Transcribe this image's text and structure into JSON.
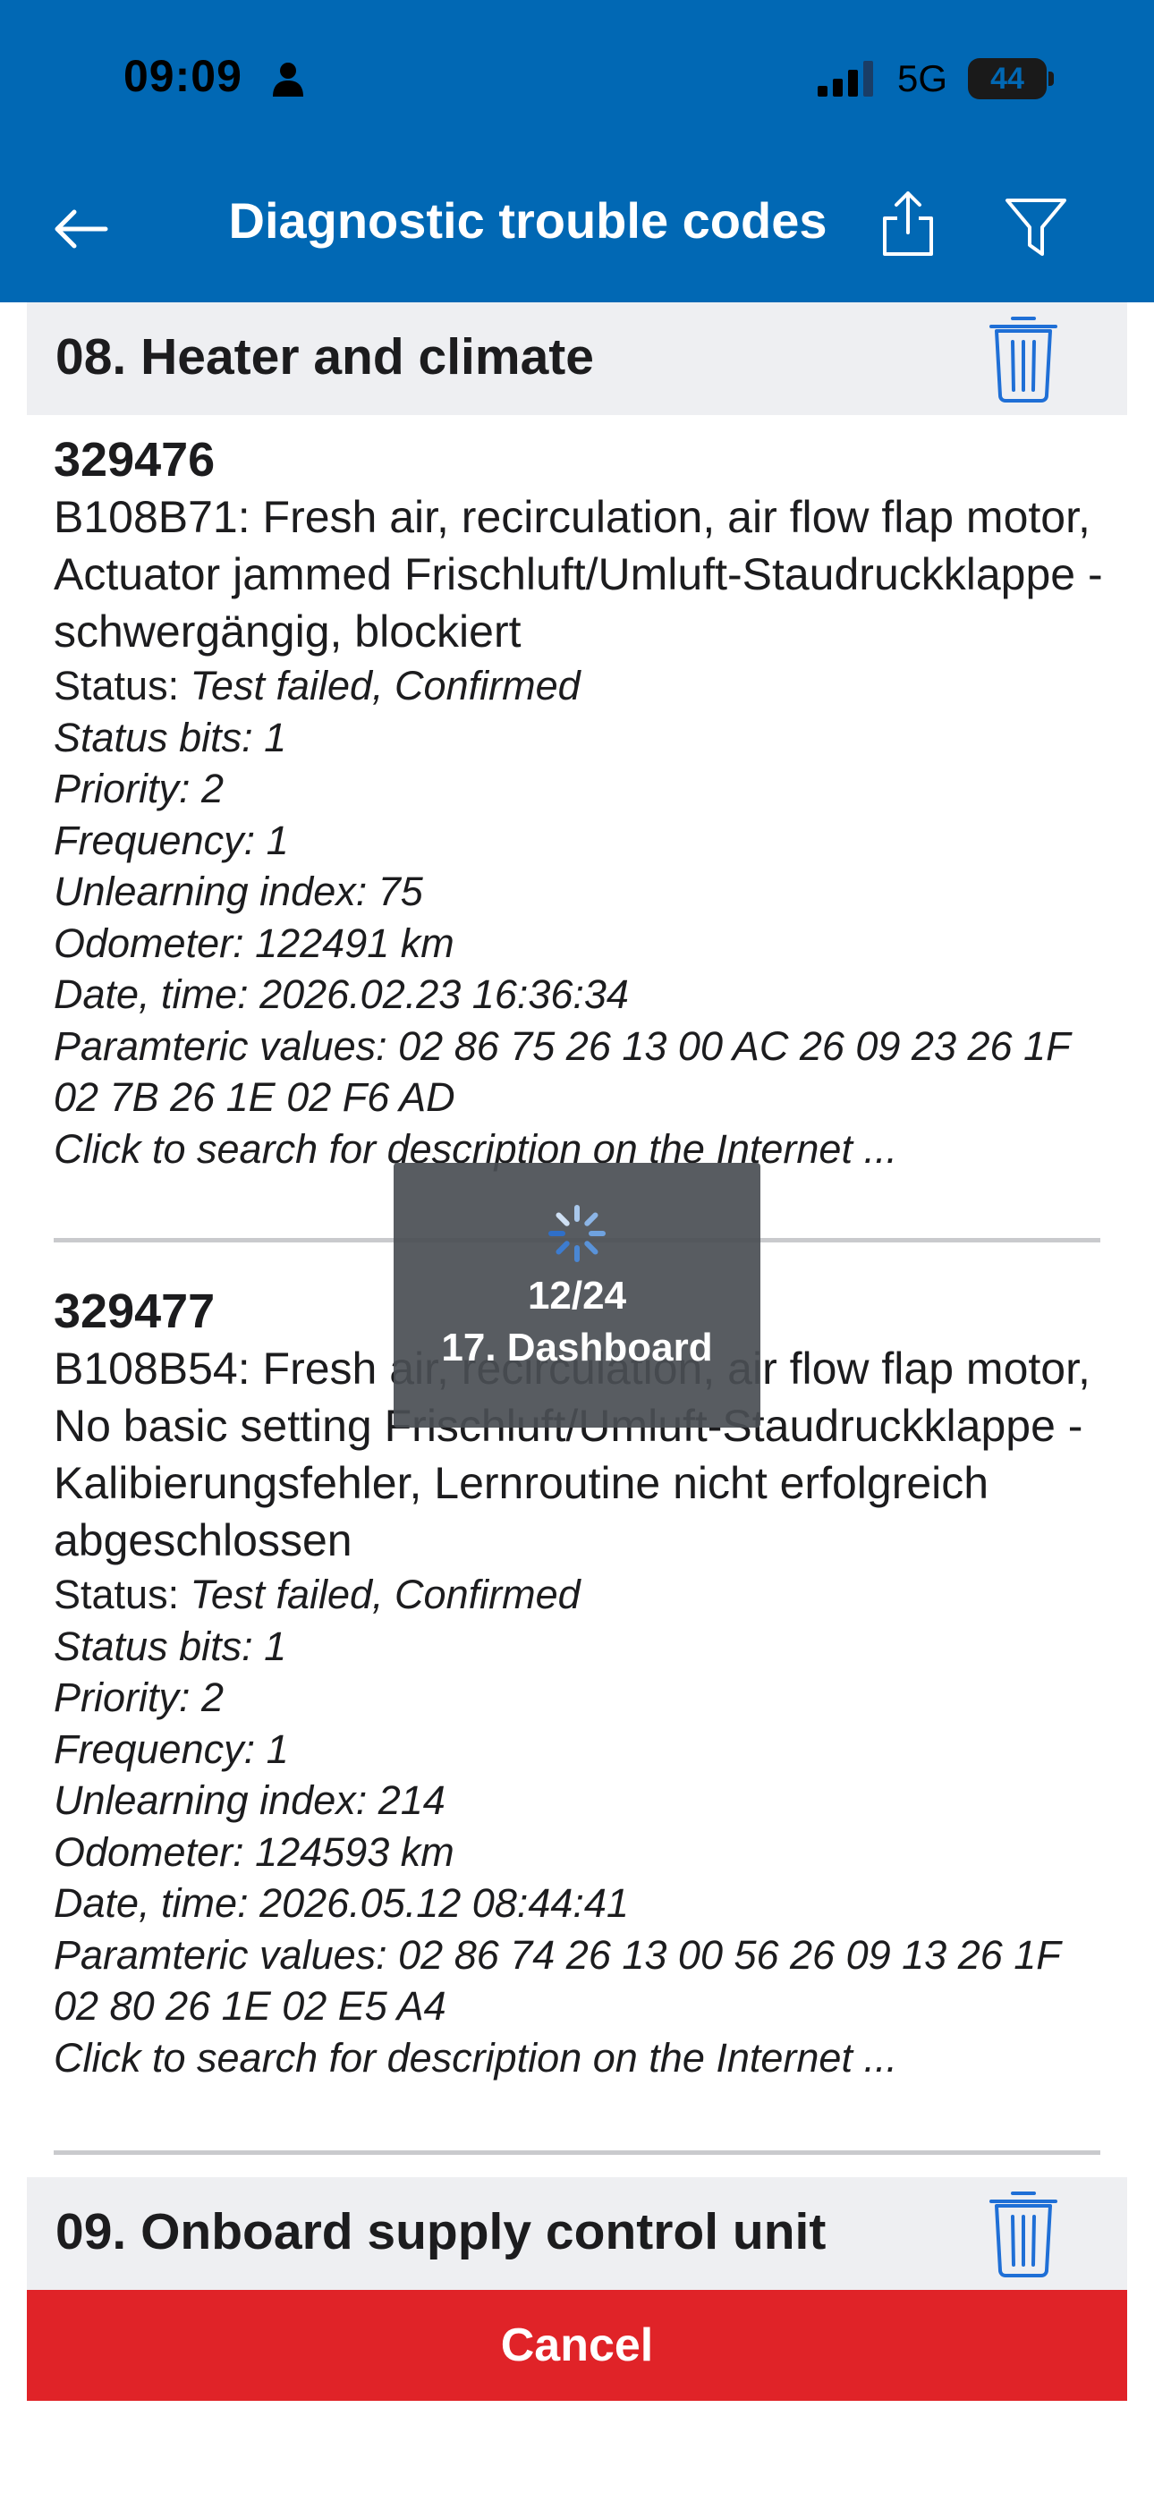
{
  "status_bar": {
    "time": "09:09",
    "network": "5G",
    "battery": "44"
  },
  "nav": {
    "title": "Diagnostic trouble codes",
    "back_icon": "arrow-left-icon",
    "share_icon": "share-icon",
    "filter_icon": "filter-icon"
  },
  "sections": [
    {
      "title": "08. Heater and climate",
      "trash_icon": "trash-icon",
      "codes": [
        {
          "id": "329476",
          "description": "B108B71: Fresh air, recirculation, air flow flap motor, Actuator jammed Frischluft/Umluft-Staudruckklappe - schwergängig, blockiert",
          "status_label": "Status: ",
          "status_value": "Test failed, Confirmed",
          "status_bits": "Status bits: 1",
          "priority": "Priority: 2",
          "frequency": "Frequency: 1",
          "unlearning_index": "Unlearning index: 75",
          "odometer": "Odometer: 122491 km",
          "date_time": "Date, time: 2026.02.23 16:36:34",
          "parametric_values": "Paramteric values:  02 86 75 26 13 00 AC 26 09 23 26 1F 02 7B 26 1E 02 F6 AD",
          "search_link": "Click to search for description on the Internet ..."
        },
        {
          "id": "329477",
          "description": "B108B54: Fresh air, recirculation, air flow flap motor, No basic setting Frischluft/Umluft-Staudruckklappe - Kalibierungsfehler, Lernroutine nicht erfolgreich abgeschlossen",
          "status_label": "Status: ",
          "status_value": "Test failed, Confirmed",
          "status_bits": "Status bits: 1",
          "priority": "Priority: 2",
          "frequency": "Frequency: 1",
          "unlearning_index": "Unlearning index: 214",
          "odometer": "Odometer: 124593 km",
          "date_time": "Date, time: 2026.05.12 08:44:41",
          "parametric_values": "Paramteric values:  02 86 74 26 13 00 56 26 09 13 26 1F 02 80 26 1E 02 E5 A4",
          "search_link": "Click to search for description on the Internet ..."
        }
      ]
    },
    {
      "title": "09. Onboard supply control unit",
      "trash_icon": "trash-icon"
    }
  ],
  "progress": {
    "count": "12/24",
    "current": "17. Dashboard"
  },
  "cancel_label": "Cancel",
  "colors": {
    "header_blue": "#0168b4",
    "cancel_red": "#e02328",
    "icon_blue": "#1f6fd6"
  }
}
